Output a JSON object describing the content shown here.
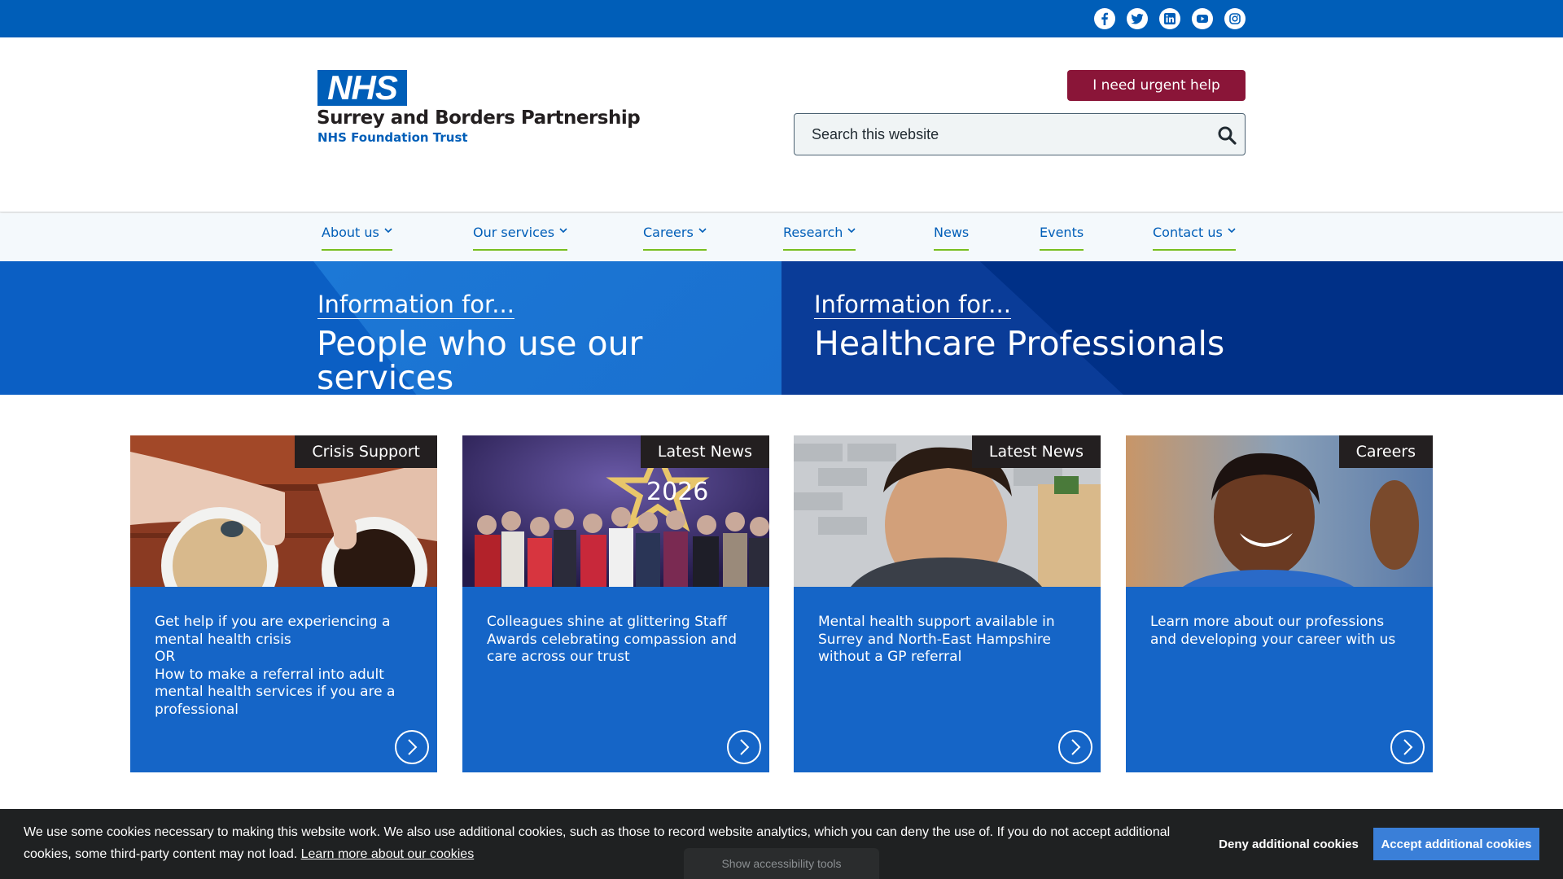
{
  "topbar": {
    "social": [
      {
        "name": "facebook-icon"
      },
      {
        "name": "twitter-icon"
      },
      {
        "name": "linkedin-icon"
      },
      {
        "name": "youtube-icon"
      },
      {
        "name": "instagram-icon"
      }
    ]
  },
  "header": {
    "logo_text": "NHS",
    "org_name": "Surrey and Borders Partnership",
    "org_sub": "NHS Foundation Trust",
    "urgent_label": "I need urgent help",
    "search_placeholder": "Search this website"
  },
  "nav": {
    "items": [
      {
        "label": "About us",
        "dropdown": true
      },
      {
        "label": "Our services",
        "dropdown": true
      },
      {
        "label": "Careers",
        "dropdown": true
      },
      {
        "label": "Research",
        "dropdown": true
      },
      {
        "label": "News",
        "dropdown": false
      },
      {
        "label": "Events",
        "dropdown": false
      },
      {
        "label": "Contact us",
        "dropdown": true
      }
    ]
  },
  "banners": [
    {
      "info_for": "Information for...",
      "title": "People who use our services"
    },
    {
      "info_for": "Information for...",
      "title": "Healthcare Professionals"
    }
  ],
  "cards": [
    {
      "tag": "Crisis Support",
      "text_lines": [
        "Get help if you are experiencing a mental health crisis",
        "OR",
        "How to make a referral into adult mental health services if you are a professional"
      ]
    },
    {
      "tag": "Latest News",
      "text_lines": [
        "Colleagues shine at glittering Staff Awards celebrating compassion and care across our trust"
      ],
      "image_text": "2026"
    },
    {
      "tag": "Latest News",
      "text_lines": [
        "Mental health support available in Surrey and North-East Hampshire without a GP referral"
      ]
    },
    {
      "tag": "Careers",
      "text_lines": [
        "Learn more about our professions and developing your career with us"
      ]
    }
  ],
  "cookie": {
    "text": "We use some cookies necessary to making this website work. We also use additional cookies, such as those to record website analytics, which you can deny the use of. If you do not accept additional cookies, some third-party content may not load.",
    "link_label": "Learn more about our cookies",
    "deny_label": "Deny additional cookies",
    "accept_label": "Accept additional cookies"
  },
  "a11y_label": "Show accessibility tools",
  "colors": {
    "nhs_blue": "#005eb8",
    "urgent": "#8a1538",
    "nav_underline": "#78be20",
    "dark_blue": "#003087",
    "accept": "#3a7fd8"
  }
}
